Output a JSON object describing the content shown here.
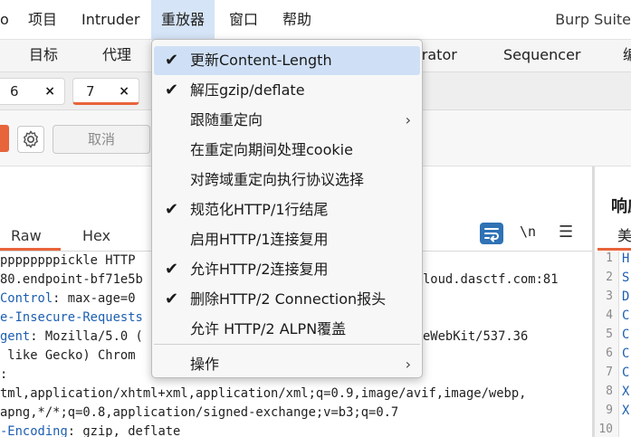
{
  "menubar": {
    "items": [
      "o",
      "项目",
      "Intruder",
      "重放器",
      "窗口",
      "帮助"
    ],
    "app_title": "Burp Suite"
  },
  "tooltabs": {
    "items": [
      "目标",
      "代理",
      "orator",
      "Sequencer",
      "编"
    ]
  },
  "request_tabs": [
    {
      "label": "6",
      "close": "×"
    },
    {
      "label": "7",
      "close": "×"
    }
  ],
  "toolbar": {
    "cancel_label": "取消"
  },
  "request": {
    "subtabs": [
      "Raw",
      "Hex"
    ],
    "newline_label": "\\n",
    "lines": [
      {
        "key": "",
        "value": "ppppppppickle HTTP"
      },
      {
        "key": "",
        "value": "80.endpoint-bf71e5b"
      },
      {
        "key": "Control",
        "value": ": max-age=0"
      },
      {
        "key": "e-Insecure-Requests",
        "value": ""
      },
      {
        "key": "gent",
        "value": ": Mozilla/5.0 ("
      },
      {
        "key": "",
        "value": " like Gecko) Chrom"
      },
      {
        "key": "",
        "value": ":"
      },
      {
        "key": "",
        "value": "tml,application/xhtml+xml,application/xml;q=0.9,image/avif,image/webp,"
      },
      {
        "key": "",
        "value": "apng,*/*;q=0.8,application/signed-exchange;v=b3;q=0.7"
      },
      {
        "key": "-Encoding",
        "value": ": gzip, deflate"
      }
    ],
    "right_fragments": [
      {
        "line": 1,
        "text": "loud.dasctf.com:81"
      },
      {
        "line": 4,
        "text": "eWebKit/537.36"
      }
    ]
  },
  "response": {
    "title": "响应",
    "tab": "美",
    "line_numbers": [
      "1",
      "2",
      "3",
      "4",
      "5",
      "6",
      "7",
      "8",
      "9",
      "10"
    ],
    "line_starts": [
      "H",
      "S",
      "D",
      "C",
      "C",
      "C",
      "C",
      "X",
      "X",
      ""
    ]
  },
  "dropdown": {
    "items": [
      {
        "label": "更新Content-Length",
        "checked": true,
        "submenu": false,
        "highlighted": true
      },
      {
        "label": "解压gzip/deflate",
        "checked": true,
        "submenu": false
      },
      {
        "label": "跟随重定向",
        "checked": false,
        "submenu": true
      },
      {
        "label": "在重定向期间处理cookie",
        "checked": false,
        "submenu": false
      },
      {
        "label": "对跨域重定向执行协议选择",
        "checked": false,
        "submenu": false
      },
      {
        "label": "规范化HTTP/1行结尾",
        "checked": true,
        "submenu": false
      },
      {
        "label": "启用HTTP/1连接复用",
        "checked": false,
        "submenu": false
      },
      {
        "label": "允许HTTP/2连接复用",
        "checked": true,
        "submenu": false
      },
      {
        "label": "删除HTTP/2 Connection报头",
        "checked": true,
        "submenu": false
      },
      {
        "label": "允许 HTTP/2 ALPN覆盖",
        "checked": false,
        "submenu": false
      },
      {
        "label": "操作",
        "checked": false,
        "submenu": true
      }
    ],
    "check_glyph": "✔",
    "arrow_glyph": "›"
  },
  "colors": {
    "accent": "#e8643a",
    "highlight": "#cfe0f6",
    "key_blue": "#1d5fb2"
  }
}
